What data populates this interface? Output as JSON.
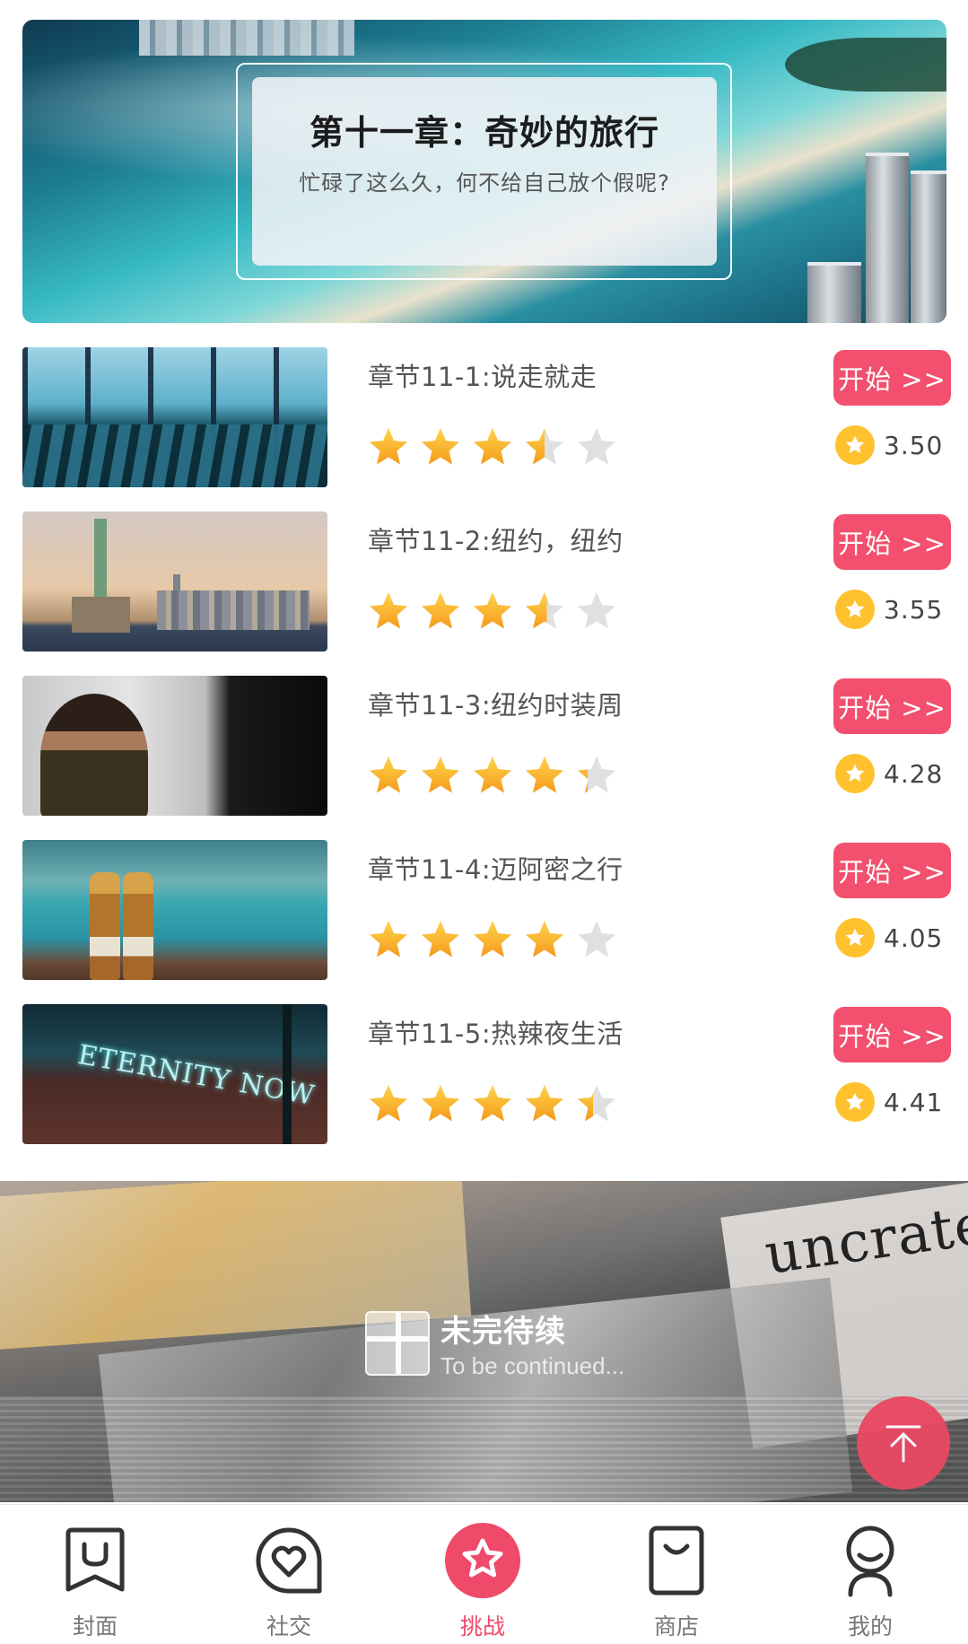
{
  "hero": {
    "title": "第十一章：奇妙的旅行",
    "subtitle": "忙碌了这么久，何不给自己放个假呢?"
  },
  "chapters": [
    {
      "title": "章节11-1:说走就走",
      "button": "开始 >>",
      "rating": 3.5,
      "score": "3.50",
      "thumb": "airport-lounge"
    },
    {
      "title": "章节11-2:纽约，纽约",
      "button": "开始 >>",
      "rating": 3.55,
      "score": "3.55",
      "thumb": "statue-of-liberty"
    },
    {
      "title": "章节11-3:纽约时装周",
      "button": "开始 >>",
      "rating": 4.28,
      "score": "4.28",
      "thumb": "fashion-models"
    },
    {
      "title": "章节11-4:迈阿密之行",
      "button": "开始 >>",
      "rating": 4.05,
      "score": "4.05",
      "thumb": "beach-bottles"
    },
    {
      "title": "章节11-5:热辣夜生活",
      "button": "开始 >>",
      "rating": 4.41,
      "score": "4.41",
      "thumb": "neon-sign"
    }
  ],
  "thumb_texts": {
    "neon": "ETERNITY NOW",
    "magazine": "uncrate"
  },
  "continued": {
    "main": "未完待续",
    "sub": "To be continued..."
  },
  "nav": [
    {
      "label": "封面",
      "icon": "cover-icon",
      "active": false
    },
    {
      "label": "社交",
      "icon": "heart-icon",
      "active": false
    },
    {
      "label": "挑战",
      "icon": "star-badge-icon",
      "active": true
    },
    {
      "label": "商店",
      "icon": "shopping-bag-icon",
      "active": false
    },
    {
      "label": "我的",
      "icon": "profile-icon",
      "active": false
    }
  ],
  "colors": {
    "accent": "#f2506e",
    "star_filled": "#fbb12b",
    "star_empty": "#e0e0e0",
    "score_badge": "#ffc22e",
    "nav_inactive": "#777777"
  }
}
